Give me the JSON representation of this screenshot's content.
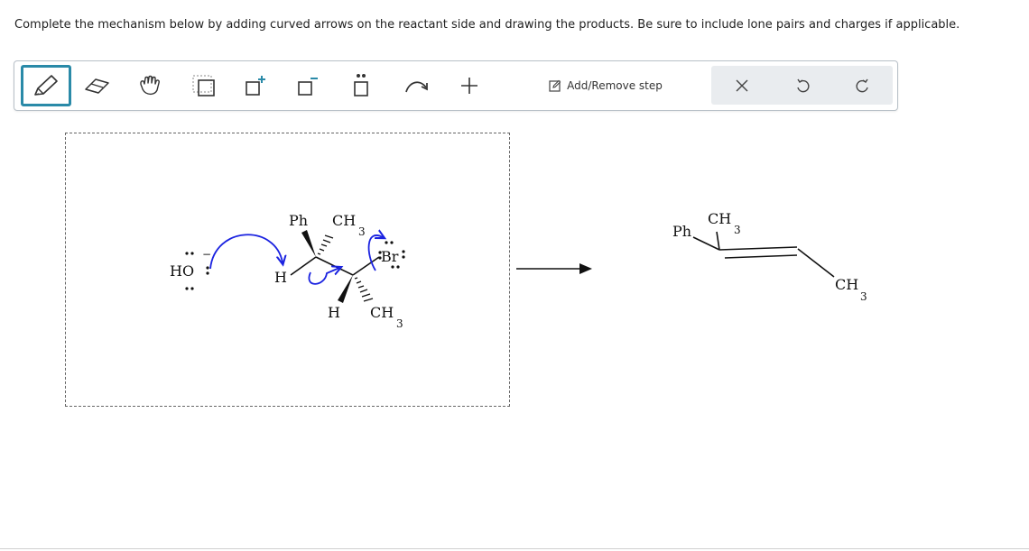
{
  "instructions": "Complete the mechanism below by adding curved arrows on the reactant side and drawing the products. Be sure to include lone pairs and charges if applicable.",
  "toolbar": {
    "tools": [
      {
        "name": "pencil-icon"
      },
      {
        "name": "eraser-icon"
      },
      {
        "name": "hand-icon"
      },
      {
        "name": "select-box-icon"
      },
      {
        "name": "positive-charge-icon"
      },
      {
        "name": "negative-charge-icon"
      },
      {
        "name": "lone-pair-icon"
      },
      {
        "name": "curved-arrow-icon"
      },
      {
        "name": "plus-icon"
      }
    ],
    "add_remove_step": "Add/Remove step",
    "actions": [
      "clear-icon",
      "undo-icon",
      "redo-icon"
    ]
  },
  "reactant": {
    "hydroxide": "HO",
    "hydroxide_charge": "−",
    "ph": "Ph",
    "ch3_top": "CH",
    "ch3_top_sub": "3",
    "h_left": "H",
    "br": "Br",
    "h_bottom": "H",
    "ch3_bottom": "CH",
    "ch3_bottom_sub": "3"
  },
  "product": {
    "ph": "Ph",
    "ch3_top": "CH",
    "ch3_top_sub": "3",
    "ch3_right": "CH",
    "ch3_right_sub": "3"
  },
  "colors": {
    "accent": "#2a8aa8",
    "arrow_blue": "#1a22e0"
  }
}
